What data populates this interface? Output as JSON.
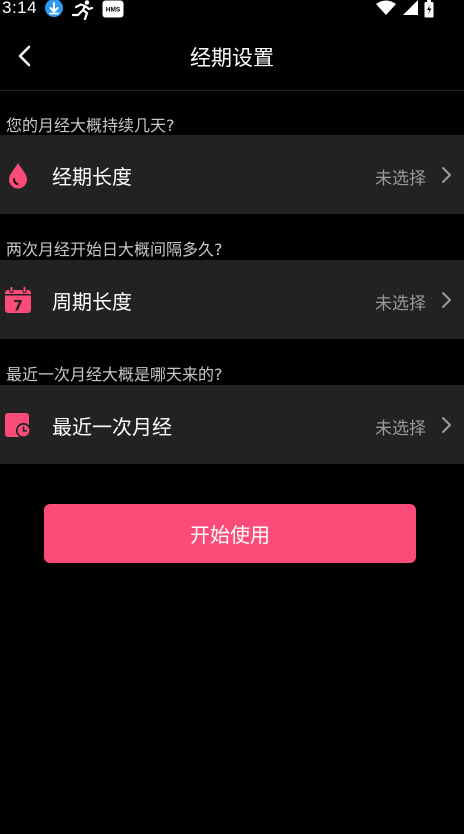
{
  "status_bar": {
    "time": "3:14",
    "left_icons": [
      "download-badge-icon",
      "running-icon",
      "hms-icon"
    ],
    "hms_label": "HMS",
    "right_icons": [
      "wifi-icon",
      "cell-signal-icon",
      "battery-icon"
    ]
  },
  "header": {
    "title": "经期设置",
    "back_icon": "chevron-left-icon"
  },
  "sections": [
    {
      "question": "您的月经大概持续几天?",
      "label": "经期长度",
      "value": "未选择",
      "icon": "drop-icon"
    },
    {
      "question": "两次月经开始日大概间隔多久?",
      "label": "周期长度",
      "value": "未选择",
      "icon": "calendar-icon",
      "icon_text": "7"
    },
    {
      "question": "最近一次月经大概是哪天来的?",
      "label": "最近一次月经",
      "value": "未选择",
      "icon": "calendar-clock-icon"
    }
  ],
  "primary_button": {
    "label": "开始使用"
  },
  "colors": {
    "background": "#000000",
    "row_background": "#222222",
    "accent": "#fb4b79",
    "secondary_text": "#9a9a9a",
    "question_text": "#c8c8c8"
  }
}
